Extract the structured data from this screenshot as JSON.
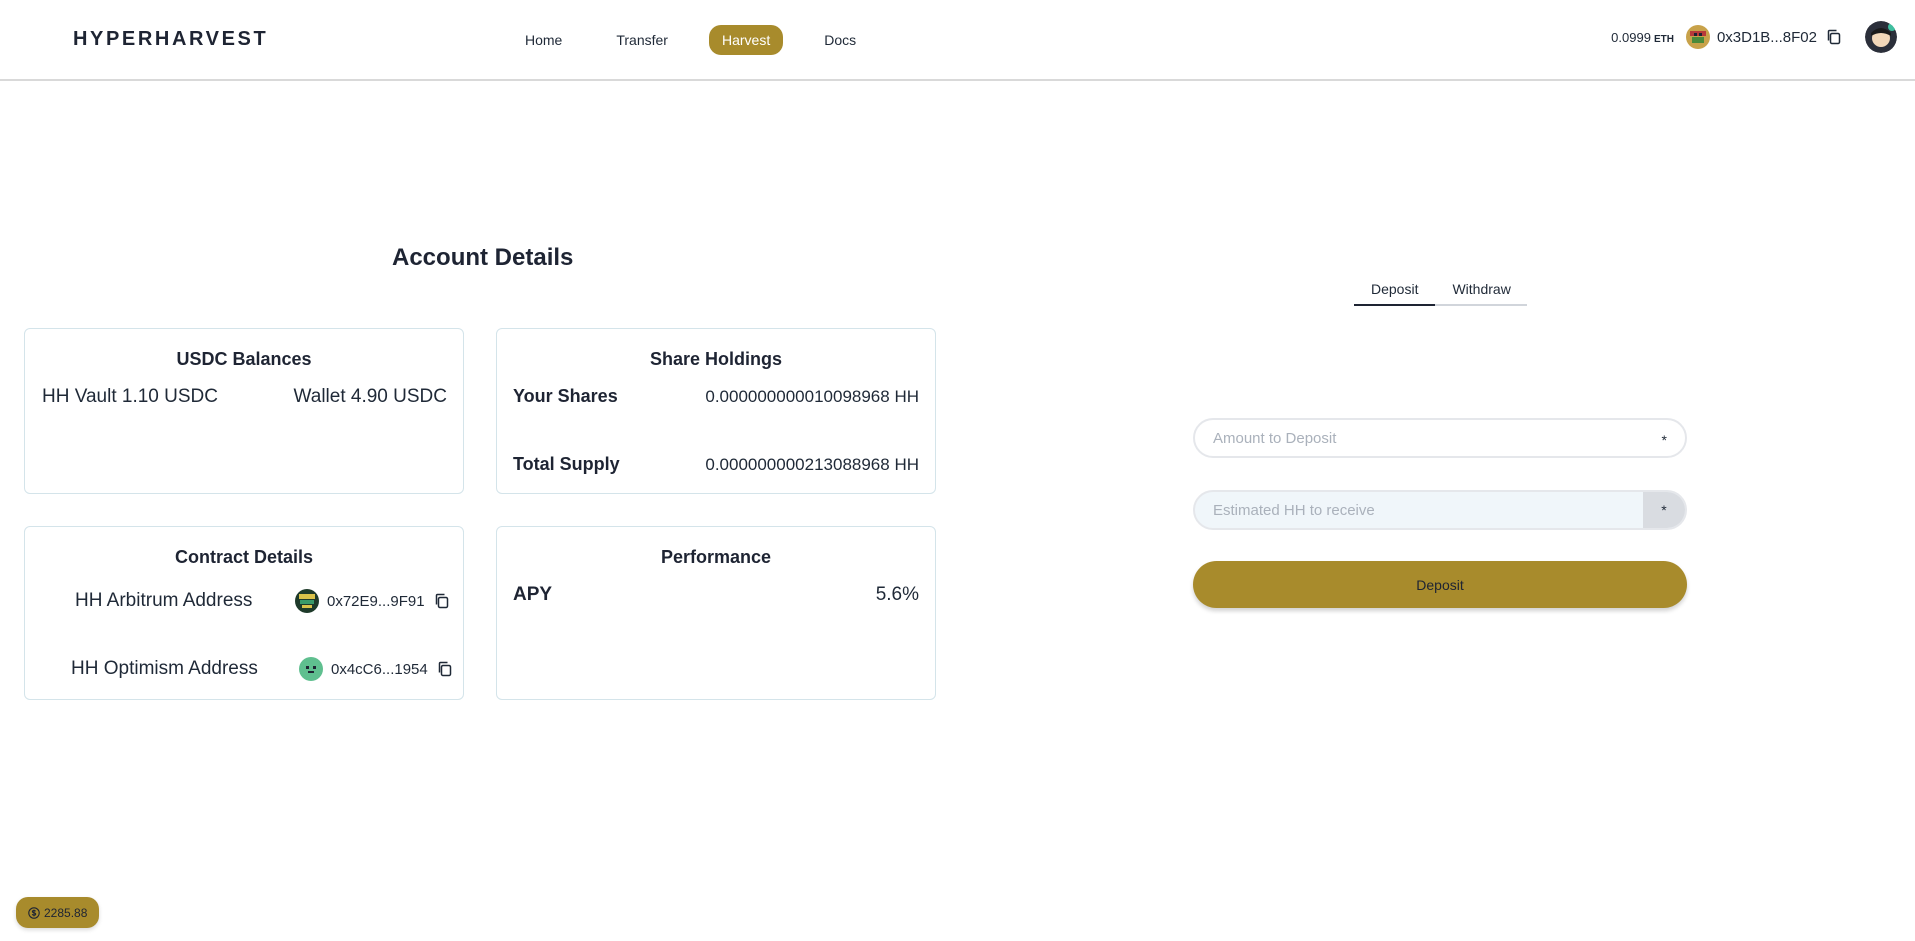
{
  "header": {
    "brand": "HYPERHARVEST",
    "nav": [
      {
        "label": "Home",
        "active": false
      },
      {
        "label": "Transfer",
        "active": false
      },
      {
        "label": "Harvest",
        "active": true
      },
      {
        "label": "Docs",
        "active": false
      }
    ],
    "eth_balance": "0.0999",
    "eth_unit": "ETH",
    "wallet_address": "0x3D1B...8F02"
  },
  "main": {
    "title": "Account Details",
    "usdc_balances": {
      "title": "USDC Balances",
      "vault": "HH Vault 1.10 USDC",
      "wallet": "Wallet 4.90 USDC"
    },
    "share_holdings": {
      "title": "Share Holdings",
      "your_shares_label": "Your Shares",
      "your_shares_value": "0.000000000010098968 HH",
      "total_supply_label": "Total Supply",
      "total_supply_value": "0.000000000213088968 HH"
    },
    "contract_details": {
      "title": "Contract Details",
      "arbitrum_label": "HH Arbitrum Address",
      "arbitrum_address": "0x72E9...9F91",
      "optimism_label": "HH Optimism Address",
      "optimism_address": "0x4cC6...1954"
    },
    "performance": {
      "title": "Performance",
      "apy_label": "APY",
      "apy_value": "5.6%"
    }
  },
  "form": {
    "tabs": [
      {
        "label": "Deposit",
        "active": true
      },
      {
        "label": "Withdraw",
        "active": false
      }
    ],
    "amount_placeholder": "Amount to Deposit",
    "estimate_placeholder": "Estimated HH to receive",
    "required_mark": "*",
    "submit_label": "Deposit"
  },
  "footer": {
    "price": "2285.88"
  },
  "colors": {
    "accent": "#a88b2c",
    "text_dark": "#1e2433",
    "card_border": "#d4e4ea"
  }
}
